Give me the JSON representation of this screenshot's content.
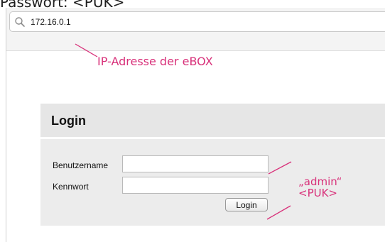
{
  "caption": {
    "top_text": "Passwort: <PUK>"
  },
  "browser": {
    "url": "172.16.0.1",
    "search_icon": "search-icon"
  },
  "annotations": {
    "ip_note": "IP-Adresse der eBOX",
    "username_note": "„admin“",
    "password_note": "<PUK>",
    "color": "#d8317a"
  },
  "login": {
    "title": "Login",
    "username_label": "Benutzername",
    "username_value": "",
    "password_label": "Kennwort",
    "password_value": "",
    "submit_label": "Login"
  }
}
